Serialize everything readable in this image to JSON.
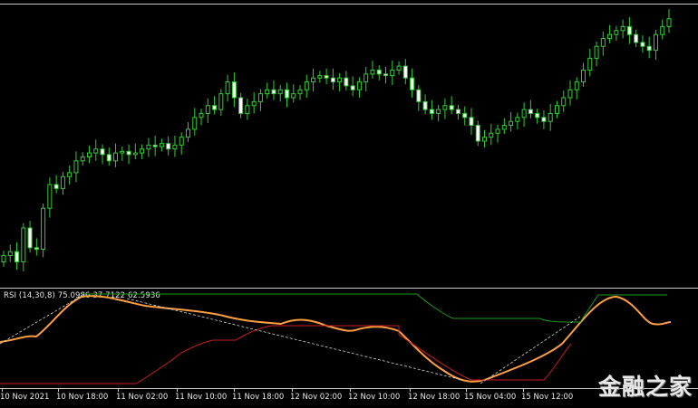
{
  "chart_data": [
    {
      "type": "candlestick",
      "title": "",
      "up_color": "#32cd32",
      "down_color": "#ffffff",
      "background": "#000000",
      "grid": false,
      "candles_close_relative": [
        20,
        25,
        12,
        55,
        30,
        28,
        80,
        110,
        105,
        120,
        125,
        140,
        145,
        150,
        155,
        148,
        140,
        150,
        152,
        148,
        150,
        155,
        160,
        158,
        162,
        155,
        160,
        170,
        180,
        195,
        200,
        210,
        205,
        225,
        240,
        220,
        200,
        210,
        215,
        225,
        230,
        225,
        230,
        220,
        225,
        230,
        240,
        245,
        248,
        245,
        240,
        245,
        235,
        230,
        240,
        250,
        255,
        250,
        248,
        255,
        260,
        245,
        230,
        215,
        205,
        200,
        205,
        210,
        205,
        200,
        195,
        185,
        165,
        170,
        175,
        180,
        185,
        190,
        195,
        205,
        200,
        195,
        190,
        200,
        210,
        220,
        230,
        240,
        255,
        270,
        285,
        295,
        300,
        305,
        310,
        300,
        290,
        285,
        280,
        300,
        310,
        320
      ]
    },
    {
      "type": "line",
      "indicator": "RSI",
      "series": [
        {
          "name": "RSI",
          "color": "#ffa040"
        },
        {
          "name": "",
          "color": "#1e9a1e"
        },
        {
          "name": "",
          "color": "#c81e1e"
        },
        {
          "name": "",
          "color": "#cfcfcf",
          "style": "dashed"
        }
      ]
    }
  ],
  "indicator_label": "RSI (14,30,8) 75.0986 37.7122 62.5936",
  "time_axis": [
    "10 Nov 2021",
    "10 Nov 18:00",
    "11 Nov 02:00",
    "11 Nov 10:00",
    "11 Nov 18:00",
    "12 Nov 02:00",
    "12 Nov 10:00",
    "12 Nov 18:00",
    "15 Nov 04:00",
    "15 Nov 12:00"
  ],
  "watermark": "金融之家"
}
